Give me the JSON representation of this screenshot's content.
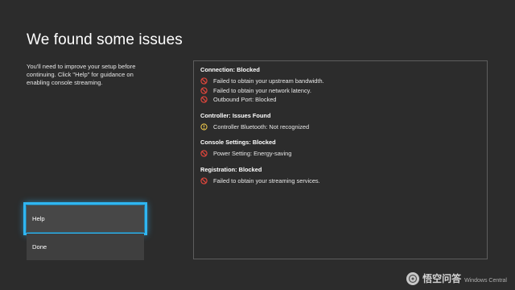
{
  "page": {
    "title": "We found some issues",
    "description": "You'll need to improve your setup before continuing. Click \"Help\" for guidance on enabling console streaming."
  },
  "menu": {
    "help_label": "Help",
    "done_label": "Done"
  },
  "issues": {
    "connection": {
      "title": "Connection: Blocked",
      "items": [
        "Failed to obtain your upstream bandwidth.",
        "Failed to obtain your network latency.",
        "Outbound Port: Blocked"
      ]
    },
    "controller": {
      "title": "Controller: Issues Found",
      "items": [
        "Controller Bluetooth: Not recognized"
      ]
    },
    "console_settings": {
      "title": "Console Settings: Blocked",
      "items": [
        "Power Setting: Energy-saving"
      ]
    },
    "registration": {
      "title": "Registration: Blocked",
      "items": [
        "Failed to obtain your streaming services."
      ]
    }
  },
  "icons": {
    "blocked": "blocked-icon",
    "warning": "warning-icon"
  },
  "colors": {
    "focus_accent": "#2fb6f2",
    "blocked_red": "#e0463c",
    "warning_yellow": "#e8c34a"
  },
  "watermark": {
    "text": "悟空问答",
    "sub": "Windows Central"
  }
}
